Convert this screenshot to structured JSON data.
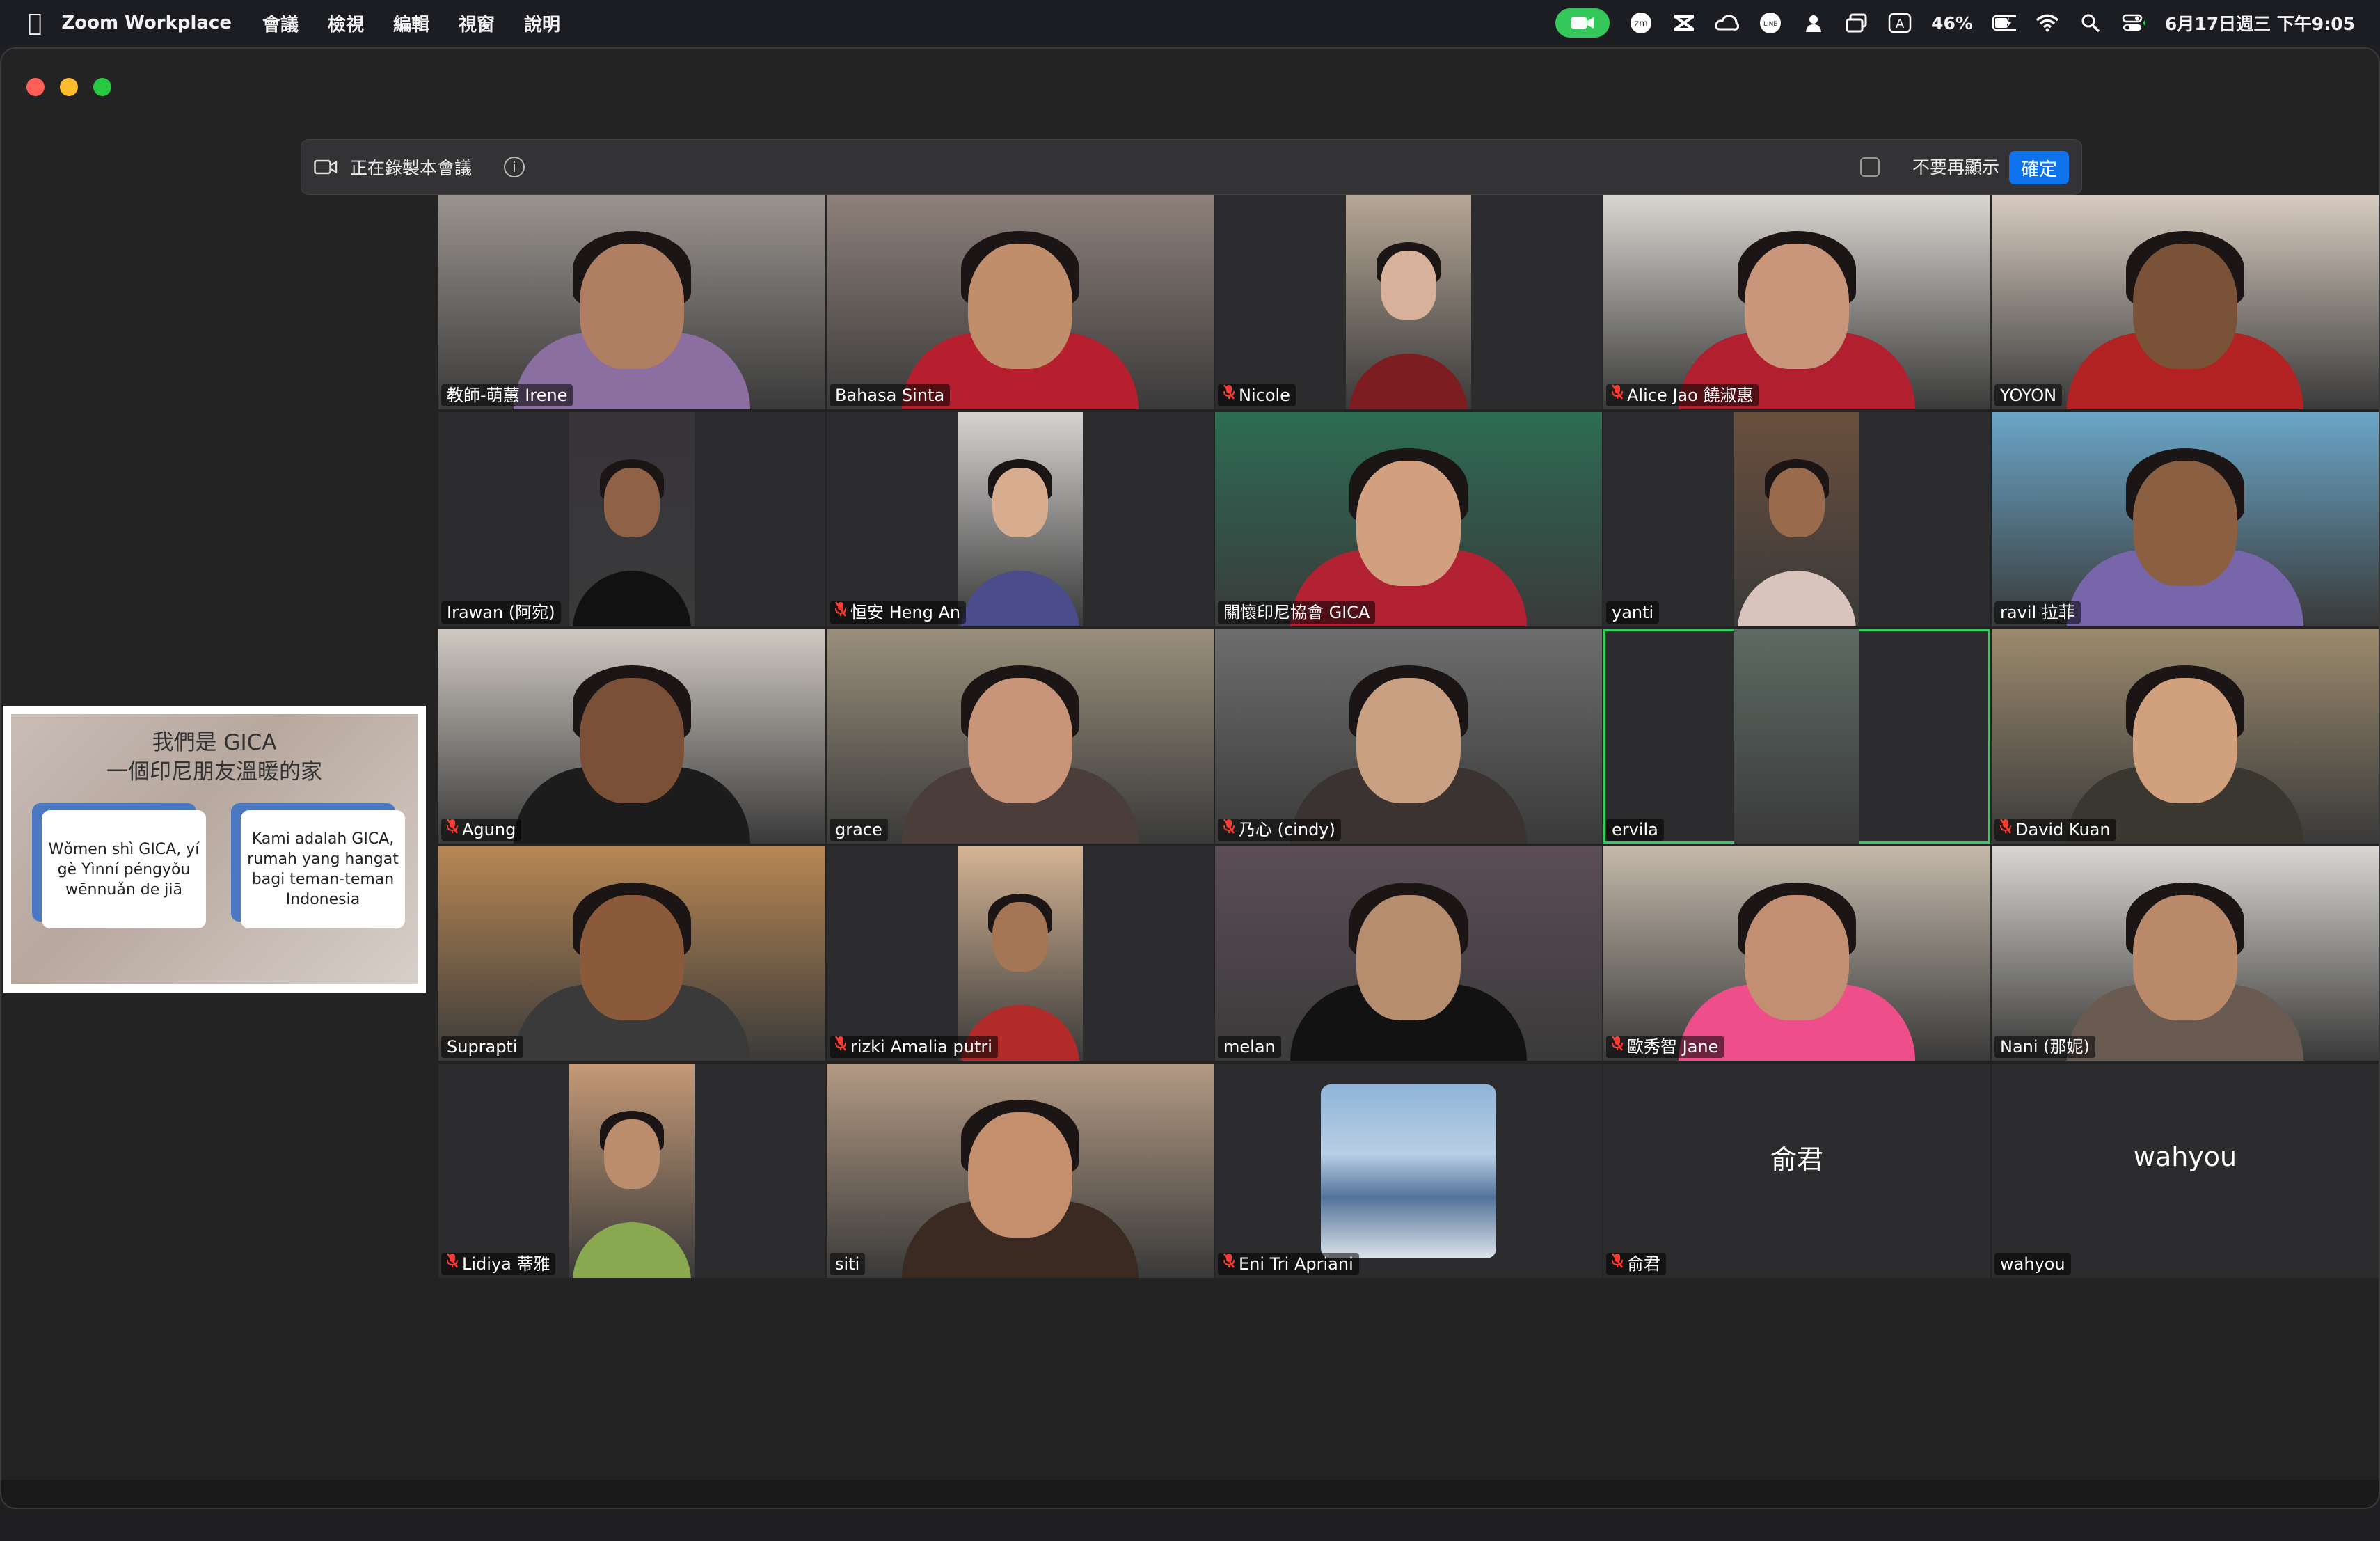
{
  "menubar": {
    "app_name": "Zoom Workplace",
    "menus": [
      "會議",
      "檢視",
      "編輯",
      "視窗",
      "說明"
    ],
    "battery": "46%",
    "input_indicator": "A",
    "datetime": "6月17日週三 下午9:05"
  },
  "banner": {
    "recording_text": "正在錄製本會議",
    "dont_show_label": "不要再顯示",
    "ok_label": "確定"
  },
  "share": {
    "title_line1": "我們是 GICA",
    "title_line2": "一個印尼朋友溫暖的家",
    "card1": "Wǒmen shì GICA, yí gè Yìnní péngyǒu wēnnuǎn de jiā",
    "card2": "Kami adalah GICA, rumah yang hangat bagi teman-teman Indonesia"
  },
  "participants": [
    {
      "name": "教師-萌蕙 Irene",
      "muted": false,
      "bg": "#9a948f",
      "skin": "#b07e62",
      "shirt": "#8b6fa0"
    },
    {
      "name": "Bahasa Sinta",
      "muted": false,
      "bg": "#8e807a",
      "skin": "#c18e6c",
      "shirt": "#b81f2e"
    },
    {
      "name": "Nicole",
      "muted": true,
      "bg": "#b6a796",
      "skin": "#d8b19a",
      "shirt": "#7d1d22"
    },
    {
      "name": "Alice Jao  饒淑惠",
      "muted": true,
      "bg": "#d9d6d0",
      "skin": "#c9957b",
      "shirt": "#b21f2f"
    },
    {
      "name": "YOYON",
      "muted": false,
      "bg": "#d8ccc0",
      "skin": "#7a5238",
      "shirt": "#b22222"
    },
    {
      "name": "Irawan (阿宛)",
      "muted": false,
      "bg": "#37343a",
      "skin": "#8f6247",
      "shirt": "#111111"
    },
    {
      "name": "恒安 Heng An",
      "muted": true,
      "bg": "#d6d4d2",
      "skin": "#d8ad8f",
      "shirt": "#4b4c8c"
    },
    {
      "name": "關懷印尼協會 GICA",
      "muted": false,
      "bg": "#2d6c55",
      "skin": "#d3a07f",
      "shirt": "#b22232"
    },
    {
      "name": "yanti",
      "muted": false,
      "bg": "#6a4f3d",
      "skin": "#9a6a4c",
      "shirt": "#d9c3bd"
    },
    {
      "name": "ravil 拉菲",
      "muted": false,
      "bg": "#6aa6c8",
      "skin": "#8b5f42",
      "shirt": "#7766aa"
    },
    {
      "name": "Agung",
      "muted": true,
      "bg": "#cfc9c2",
      "skin": "#7a5037",
      "shirt": "#1c1c1c"
    },
    {
      "name": "grace",
      "muted": false,
      "bg": "#9a8f7c",
      "skin": "#c8957a",
      "shirt": "#4a3d3a"
    },
    {
      "name": "乃心 (cindy)",
      "muted": true,
      "bg": "#6d6d6d",
      "skin": "#caa083",
      "shirt": "#3b3331"
    },
    {
      "name": "ervila",
      "muted": false,
      "bg": "#5d6b64",
      "skin": "#5d6b64",
      "shirt": "#5d6b64"
    },
    {
      "name": "David Kuan",
      "muted": true,
      "bg": "#9c8a6d",
      "skin": "#d1a07c",
      "shirt": "#3a3630"
    },
    {
      "name": "Suprapti",
      "muted": false,
      "bg": "#b88755",
      "skin": "#8a5a3b",
      "shirt": "#3a3a3a"
    },
    {
      "name": "rizki  Amalia putri",
      "muted": true,
      "bg": "#d4b494",
      "skin": "#a47655",
      "shirt": "#b22a2a"
    },
    {
      "name": "melan",
      "muted": false,
      "bg": "#5c4d57",
      "skin": "#b78d70",
      "shirt": "#121212"
    },
    {
      "name": "歐秀智 Jane",
      "muted": true,
      "bg": "#c4b9ab",
      "skin": "#c28f72",
      "shirt": "#ee4f8a"
    },
    {
      "name": "Nani (那妮)",
      "muted": false,
      "bg": "#d9d6d2",
      "skin": "#b9896a",
      "shirt": "#6a5b52"
    },
    {
      "name": "Lidiya 蒂雅",
      "muted": true,
      "bg": "#c59a77",
      "skin": "#bb8d6d",
      "shirt": "#8aa84f"
    },
    {
      "name": "siti",
      "muted": false,
      "bg": "#b39a84",
      "skin": "#c48f6c",
      "shirt": "#3a2a22"
    },
    {
      "name": "Eni Tri Apriani",
      "muted": true,
      "bg": "#2c2c2e",
      "skin": "#2c2c2e",
      "shirt": "#2c2c2e"
    },
    {
      "name": "俞君",
      "muted": true,
      "bg": "#2c2c2e",
      "skin": "#2c2c2e",
      "shirt": "#2c2c2e"
    },
    {
      "name": "wahyou",
      "muted": false,
      "bg": "#2c2c2e",
      "skin": "#2c2c2e",
      "shirt": "#2c2c2e"
    }
  ]
}
